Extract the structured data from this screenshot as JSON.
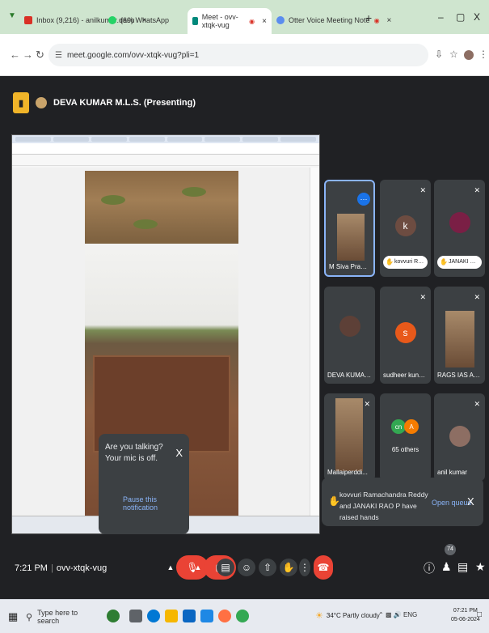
{
  "browser": {
    "tabs": [
      {
        "label": "Inbox (9,216) - anilkumar.dasu",
        "icon": "gmail-icon"
      },
      {
        "label": "(60) WhatsApp",
        "icon": "whatsapp-icon"
      },
      {
        "label": "Meet - ovv-xtqk-vug",
        "icon": "meet-icon",
        "active": true
      },
      {
        "label": "Otter Voice Meeting Note",
        "icon": "otter-icon"
      }
    ],
    "url": "meet.google.com/ovv-xtqk-vug?pli=1",
    "window_controls": [
      "–",
      "▢",
      "X"
    ]
  },
  "meet": {
    "presenter_label": "DEVA KUMAR M.L.S. (Presenting)",
    "meeting_code": "ovv-xtqk-vug",
    "time": "7:21 PM",
    "participants": [
      {
        "name": "M Siva Prasad ...",
        "active": true
      },
      {
        "name": "kovvuri Ra...",
        "initial": "k",
        "color": "#6d4c41",
        "hand": true
      },
      {
        "name": "JANAKI RA...",
        "hand": true
      },
      {
        "name": "DEVA KUMAR ..."
      },
      {
        "name": "sudheer kunap...",
        "initial": "s",
        "color": "#e8591a"
      },
      {
        "name": "RAGS IAS Acad..."
      },
      {
        "name": "Mallaiperddi..."
      },
      {
        "name": "65 others",
        "initials": [
          "cn",
          "A"
        ]
      },
      {
        "name": "anil kumar"
      }
    ],
    "toast": {
      "text": "Are you talking? Your mic is off.",
      "action": "Pause this notification",
      "close": "X"
    },
    "raised_hands": {
      "text": "kovvuri Ramachandra Reddy and JANAKI RAO P have raised hands",
      "action": "Open queue",
      "close": "X"
    },
    "people_count": "74"
  },
  "taskbar": {
    "search_placeholder": "Type here to search",
    "weather": "34°C Partly cloudy",
    "lang": "ENG",
    "clock_time": "07:21 PM",
    "clock_date": "05-06-2024"
  }
}
